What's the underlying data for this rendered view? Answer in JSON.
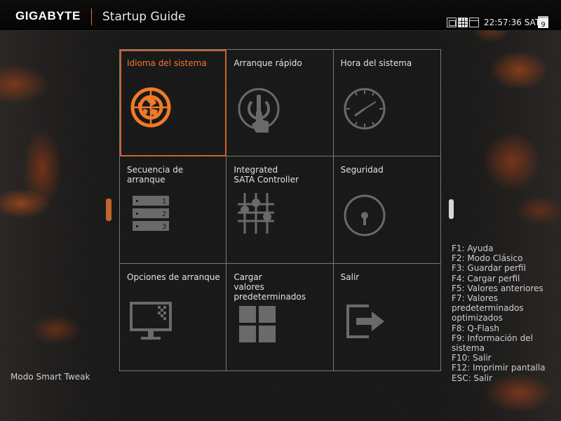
{
  "header": {
    "brand": "GIGABYTE",
    "title": "Startup Guide",
    "time": "22:57:36 SAT",
    "calendar_day": "9"
  },
  "tiles": [
    {
      "label": "Idioma del sistema",
      "icon": "globe-icon",
      "selected": true
    },
    {
      "label": "Arranque rápido",
      "icon": "power-touch-icon",
      "selected": false
    },
    {
      "label": "Hora del sistema",
      "icon": "clock-icon",
      "selected": false
    },
    {
      "label": "Secuencia de arranque",
      "icon": "boot-order-icon",
      "selected": false
    },
    {
      "label": "Integrated\nSATA Controller",
      "icon": "sliders-icon",
      "selected": false
    },
    {
      "label": "Seguridad",
      "icon": "lock-icon",
      "selected": false
    },
    {
      "label": "Opciones de arranque",
      "icon": "monitor-icon",
      "selected": false
    },
    {
      "label": "Cargar\nvalores\npredeterminados",
      "icon": "tiles-icon",
      "selected": false
    },
    {
      "label": "Salir",
      "icon": "exit-icon",
      "selected": false
    }
  ],
  "boot_order_numbers": [
    "1",
    "2",
    "3"
  ],
  "hotkeys": [
    "F1: Ayuda",
    "F2: Modo Clásico",
    "F3: Guardar perfil",
    "F4: Cargar perfil",
    "F5: Valores anteriores",
    "F7: Valores\npredeterminados\noptimizados",
    "F8: Q-Flash",
    "F9: Información del\nsistema",
    "F10: Salir",
    "F12: Imprimir pantalla",
    "ESC: Salir"
  ],
  "footer": {
    "smart_tweak": "Modo Smart Tweak"
  },
  "colors": {
    "accent": "#f07a28",
    "icon": "#6a6a6a"
  }
}
